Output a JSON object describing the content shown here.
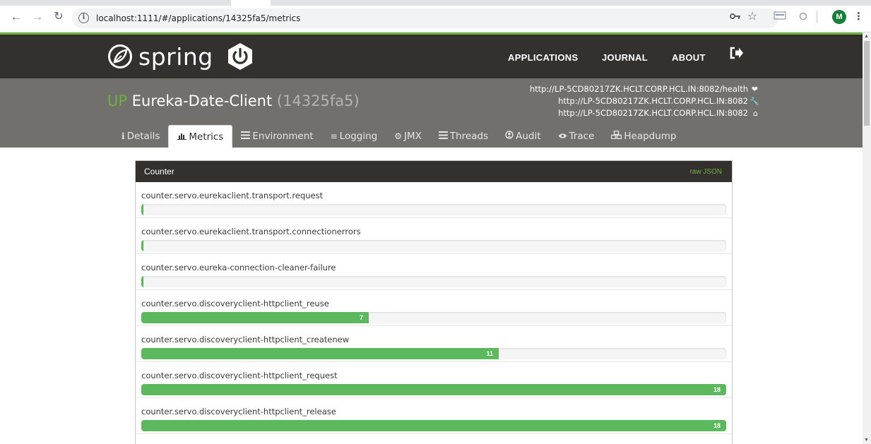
{
  "browser": {
    "url": "localhost:1111/#/applications/14325fa5/metrics",
    "profile_initial": "M"
  },
  "header": {
    "logo_text": "spring",
    "nav": [
      "APPLICATIONS",
      "JOURNAL",
      "ABOUT"
    ]
  },
  "app": {
    "status": "UP",
    "name": "Eureka-Date-Client",
    "id": "(14325fa5)",
    "urls": [
      "http://LP-5CD80217ZK.HCLT.CORP.HCL.IN:8082/health",
      "http://LP-5CD80217ZK.HCLT.CORP.HCL.IN:8082",
      "http://LP-5CD80217ZK.HCLT.CORP.HCL.IN:8082"
    ]
  },
  "tabs": [
    {
      "label": "Details",
      "icon": "info-icon"
    },
    {
      "label": "Metrics",
      "icon": "bar-chart-icon"
    },
    {
      "label": "Environment",
      "icon": "list-icon"
    },
    {
      "label": "Logging",
      "icon": "sliders-icon"
    },
    {
      "label": "JMX",
      "icon": "gears-icon"
    },
    {
      "label": "Threads",
      "icon": "list-icon"
    },
    {
      "label": "Audit",
      "icon": "user-circle-icon"
    },
    {
      "label": "Trace",
      "icon": "eye-icon"
    },
    {
      "label": "Heapdump",
      "icon": "cubes-icon"
    }
  ],
  "active_tab": "Metrics",
  "panel": {
    "title": "Counter",
    "raw_json_label": "raw JSON",
    "bar_max": 18,
    "metrics": [
      {
        "name": "counter.servo.eurekaclient.transport.request",
        "value": 0
      },
      {
        "name": "counter.servo.eurekaclient.transport.connectionerrors",
        "value": 0
      },
      {
        "name": "counter.servo.eureka-connection-cleaner-failure",
        "value": 0
      },
      {
        "name": "counter.servo.discoveryclient-httpclient_reuse",
        "value": 7
      },
      {
        "name": "counter.servo.discoveryclient-httpclient_createnew",
        "value": 11
      },
      {
        "name": "counter.servo.discoveryclient-httpclient_request",
        "value": 18
      },
      {
        "name": "counter.servo.discoveryclient-httpclient_release",
        "value": 18
      }
    ]
  },
  "colors": {
    "brand_green": "#6db33f",
    "header_dark": "#34302d",
    "subheader_gray": "#71706c",
    "bar_green": "#5cb85c"
  }
}
